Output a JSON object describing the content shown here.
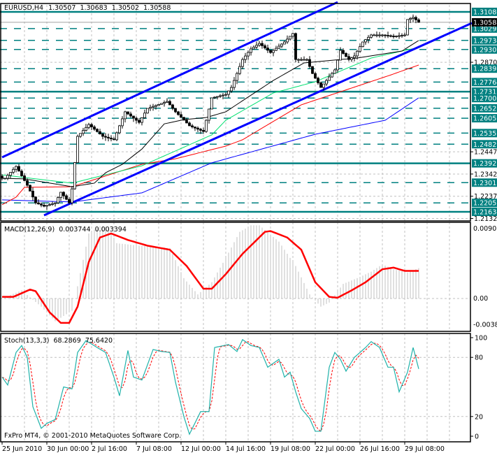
{
  "header": {
    "symbol": "EURUSD,H4",
    "open": "1.30507",
    "high": "1.30683",
    "low": "1.30502",
    "close": "1.30588"
  },
  "macd_label": {
    "name": "MACD(12,26,9)",
    "main": "0.003744",
    "signal": "0.003394"
  },
  "stoch_label": {
    "name": "Stoch(13,3,3)",
    "k": "68.2869",
    "d": "75.6420"
  },
  "copyright": "FxPro MT4, © 2001-2010 MetaQuotes Software Corp.",
  "colors": {
    "level": "#008080",
    "channel": "#0000ff",
    "ma_fast": "#000000",
    "ma_mid": "#00e070",
    "ma_slow": "#ff0000",
    "ma_long": "#0000ff",
    "macd_hist": "#c0c0c0",
    "macd_signal": "#ff0000",
    "stoch_k": "#20b2aa",
    "stoch_d": "#ff0000",
    "current_price_bg": "#000000"
  },
  "chart_data": [
    {
      "type": "candlestick",
      "title": "EURUSD,H4",
      "ylim": [
        1.2132,
        1.3108
      ],
      "current_price": "1.30588",
      "x_tick_labels": [
        "25 Jun 2010",
        "30 Jun 00:00",
        "2 Jul 16:00",
        "7 Jul 08:00",
        "12 Jul 00:00",
        "14 Jul 16:00",
        "19 Jul 08:00",
        "22 Jul 00:00",
        "26 Jul 16:00",
        "29 Jul 08:00"
      ],
      "y_tick_labels": [
        "1.28700",
        "1.24470",
        "1.23420",
        "1.22370",
        "1.21320"
      ],
      "levels": [
        {
          "price": "1.31080",
          "style": "solid"
        },
        {
          "price": "1.30292",
          "style": "dashed"
        },
        {
          "price": "1.29734",
          "style": "dashed"
        },
        {
          "price": "1.29303",
          "style": "dashed"
        },
        {
          "price": "1.28398",
          "style": "dashed"
        },
        {
          "price": "1.27764",
          "style": "dashed"
        },
        {
          "price": "1.27312",
          "style": "solid"
        },
        {
          "price": "1.27008",
          "style": "dashed"
        },
        {
          "price": "1.26526",
          "style": "dashed"
        },
        {
          "price": "1.26057",
          "style": "dashed"
        },
        {
          "price": "1.25355",
          "style": "dashed"
        },
        {
          "price": "1.24829",
          "style": "dashed"
        },
        {
          "price": "1.23925",
          "style": "solid"
        },
        {
          "price": "1.23013",
          "style": "dashed"
        },
        {
          "price": "1.22057",
          "style": "dashed"
        },
        {
          "price": "1.21634",
          "style": "solid"
        }
      ],
      "bars": 150,
      "close_waypoints": [
        [
          0,
          1.2322
        ],
        [
          1,
          1.2322
        ],
        [
          5,
          1.2378
        ],
        [
          9,
          1.2289
        ],
        [
          12,
          1.2206
        ],
        [
          15,
          1.219
        ],
        [
          19,
          1.2206
        ],
        [
          21,
          1.2256
        ],
        [
          24,
          1.2206
        ],
        [
          25,
          1.2272
        ],
        [
          27,
          1.252
        ],
        [
          31,
          1.2576
        ],
        [
          36,
          1.252
        ],
        [
          40,
          1.2504
        ],
        [
          44,
          1.2636
        ],
        [
          49,
          1.2586
        ],
        [
          52,
          1.2652
        ],
        [
          59,
          1.2685
        ],
        [
          62,
          1.2636
        ],
        [
          67,
          1.257
        ],
        [
          72,
          1.2543
        ],
        [
          75,
          1.2702
        ],
        [
          80,
          1.2718
        ],
        [
          82,
          1.2751
        ],
        [
          86,
          1.2883
        ],
        [
          89,
          1.2933
        ],
        [
          92,
          1.2959
        ],
        [
          96,
          1.2916
        ],
        [
          101,
          1.2966
        ],
        [
          104,
          1.3006
        ],
        [
          105,
          1.2883
        ],
        [
          109,
          1.2883
        ],
        [
          111,
          1.2817
        ],
        [
          114,
          1.2751
        ],
        [
          116,
          1.2784
        ],
        [
          119,
          1.2834
        ],
        [
          121,
          1.2926
        ],
        [
          124,
          1.2883
        ],
        [
          126,
          1.29
        ],
        [
          129,
          1.2966
        ],
        [
          132,
          1.2999
        ],
        [
          136,
          1.2999
        ],
        [
          140,
          1.2992
        ],
        [
          144,
          1.2999
        ],
        [
          145,
          1.3072
        ],
        [
          147,
          1.3082
        ],
        [
          149,
          1.30588
        ]
      ],
      "moving_averages": [
        {
          "name": "ma_long",
          "points": [
            [
              0,
              1.222
            ],
            [
              25,
              1.221
            ],
            [
              50,
              1.2253
            ],
            [
              75,
              1.2395
            ],
            [
              112,
              1.253
            ],
            [
              137,
              1.2596
            ],
            [
              149,
              1.2702
            ]
          ]
        },
        {
          "name": "ma_slow",
          "points": [
            [
              0,
              1.2197
            ],
            [
              5,
              1.2233
            ],
            [
              8,
              1.2279
            ],
            [
              25,
              1.2282
            ],
            [
              50,
              1.2388
            ],
            [
              62,
              1.2414
            ],
            [
              80,
              1.2474
            ],
            [
              86,
              1.2504
            ],
            [
              107,
              1.2669
            ],
            [
              122,
              1.2735
            ],
            [
              139,
              1.281
            ],
            [
              149,
              1.2857
            ]
          ]
        },
        {
          "name": "ma_mid",
          "points": [
            [
              0,
              1.2338
            ],
            [
              25,
              1.2299
            ],
            [
              50,
              1.2381
            ],
            [
              75,
              1.2527
            ],
            [
              80,
              1.2596
            ],
            [
              97,
              1.2725
            ],
            [
              112,
              1.2778
            ],
            [
              132,
              1.289
            ],
            [
              144,
              1.2926
            ],
            [
              149,
              1.294
            ]
          ]
        },
        {
          "name": "ma_fast",
          "points": [
            [
              0,
              1.2322
            ],
            [
              8,
              1.2319
            ],
            [
              25,
              1.2282
            ],
            [
              33,
              1.2299
            ],
            [
              37,
              1.2348
            ],
            [
              43,
              1.2388
            ],
            [
              50,
              1.246
            ],
            [
              58,
              1.2579
            ],
            [
              65,
              1.2599
            ],
            [
              73,
              1.2609
            ],
            [
              80,
              1.2636
            ],
            [
              97,
              1.2784
            ],
            [
              108,
              1.2867
            ],
            [
              116,
              1.2877
            ],
            [
              127,
              1.289
            ],
            [
              143,
              1.2923
            ],
            [
              149,
              1.2973
            ]
          ]
        }
      ],
      "channel": [
        {
          "name": "upper",
          "points": [
            [
              0,
              1.2421
            ],
            [
              120,
              1.3154
            ]
          ]
        },
        {
          "name": "lower",
          "points": [
            [
              15,
              1.2147
            ],
            [
              168,
              1.3055
            ]
          ]
        }
      ]
    },
    {
      "type": "bar+line",
      "title": "MACD(12,26,9)",
      "ylim": [
        -0.00381,
        0.00903
      ],
      "y_tick_labels": [
        "0.00903",
        "0.00",
        "-0.00381"
      ],
      "main": [
        [
          0,
          0
        ],
        [
          7,
          0.001
        ],
        [
          14,
          -0.001
        ],
        [
          19,
          -0.0028
        ],
        [
          25,
          -0.0015
        ],
        [
          27,
          0.0015
        ],
        [
          31,
          0.008
        ],
        [
          35,
          0.0089
        ],
        [
          38,
          0.0088
        ],
        [
          41,
          0.0068
        ],
        [
          49,
          0.0065
        ],
        [
          60,
          0.0062
        ],
        [
          65,
          0.0025
        ],
        [
          70,
          0.0005
        ],
        [
          75,
          0.002
        ],
        [
          80,
          0.005
        ],
        [
          85,
          0.0082
        ],
        [
          89,
          0.009
        ],
        [
          92,
          0.009
        ],
        [
          99,
          0.007
        ],
        [
          105,
          0.004
        ],
        [
          110,
          0.0005
        ],
        [
          114,
          -0.001
        ],
        [
          117,
          -0.0005
        ],
        [
          122,
          0.0018
        ],
        [
          127,
          0.0025
        ],
        [
          132,
          0.0033
        ],
        [
          136,
          0.0042
        ],
        [
          140,
          0.0036
        ],
        [
          145,
          0.0032
        ],
        [
          149,
          0.003744
        ]
      ],
      "signal": [
        [
          0,
          0.0002
        ],
        [
          4,
          0.0002
        ],
        [
          10,
          0.0011
        ],
        [
          12,
          0.0009
        ],
        [
          17,
          -0.0017
        ],
        [
          21,
          -0.003
        ],
        [
          24,
          -0.003
        ],
        [
          27,
          -0.001
        ],
        [
          31,
          0.0045
        ],
        [
          35,
          0.0075
        ],
        [
          39,
          0.008
        ],
        [
          45,
          0.0072
        ],
        [
          52,
          0.0065
        ],
        [
          60,
          0.006
        ],
        [
          66,
          0.004
        ],
        [
          72,
          0.0012
        ],
        [
          75,
          0.0012
        ],
        [
          80,
          0.003
        ],
        [
          86,
          0.0055
        ],
        [
          94,
          0.0082
        ],
        [
          96,
          0.0083
        ],
        [
          102,
          0.0075
        ],
        [
          107,
          0.006
        ],
        [
          112,
          0.002
        ],
        [
          117,
          0.0002
        ],
        [
          120,
          0.0001
        ],
        [
          125,
          0.001
        ],
        [
          130,
          0.002
        ],
        [
          136,
          0.0036
        ],
        [
          140,
          0.0038
        ],
        [
          144,
          0.0034
        ],
        [
          149,
          0.003394
        ]
      ]
    },
    {
      "type": "line",
      "title": "Stoch(13,3,3)",
      "ylim": [
        0,
        100
      ],
      "y_tick_labels": [
        "100",
        "80",
        "20",
        "0"
      ],
      "k": [
        [
          0,
          60
        ],
        [
          2,
          52
        ],
        [
          5,
          85
        ],
        [
          7,
          92
        ],
        [
          9,
          80
        ],
        [
          11,
          30
        ],
        [
          14,
          8
        ],
        [
          16,
          13
        ],
        [
          19,
          17
        ],
        [
          22,
          50
        ],
        [
          25,
          48
        ],
        [
          27,
          85
        ],
        [
          30,
          97
        ],
        [
          34,
          90
        ],
        [
          37,
          85
        ],
        [
          40,
          60
        ],
        [
          42,
          41
        ],
        [
          45,
          87
        ],
        [
          47,
          60
        ],
        [
          50,
          57
        ],
        [
          54,
          88
        ],
        [
          57,
          86
        ],
        [
          60,
          85
        ],
        [
          62,
          55
        ],
        [
          65,
          20
        ],
        [
          67,
          2
        ],
        [
          71,
          25
        ],
        [
          74,
          25
        ],
        [
          76,
          90
        ],
        [
          81,
          93
        ],
        [
          84,
          86
        ],
        [
          86,
          98
        ],
        [
          89,
          92
        ],
        [
          92,
          90
        ],
        [
          95,
          70
        ],
        [
          99,
          78
        ],
        [
          101,
          60
        ],
        [
          103,
          65
        ],
        [
          105,
          45
        ],
        [
          107,
          28
        ],
        [
          110,
          18
        ],
        [
          112,
          5
        ],
        [
          114,
          5
        ],
        [
          117,
          70
        ],
        [
          119,
          85
        ],
        [
          121,
          78
        ],
        [
          123,
          66
        ],
        [
          126,
          80
        ],
        [
          130,
          90
        ],
        [
          132,
          96
        ],
        [
          135,
          90
        ],
        [
          138,
          70
        ],
        [
          140,
          70
        ],
        [
          142,
          45
        ],
        [
          145,
          65
        ],
        [
          147,
          90
        ],
        [
          149,
          68.29
        ]
      ]
    }
  ]
}
